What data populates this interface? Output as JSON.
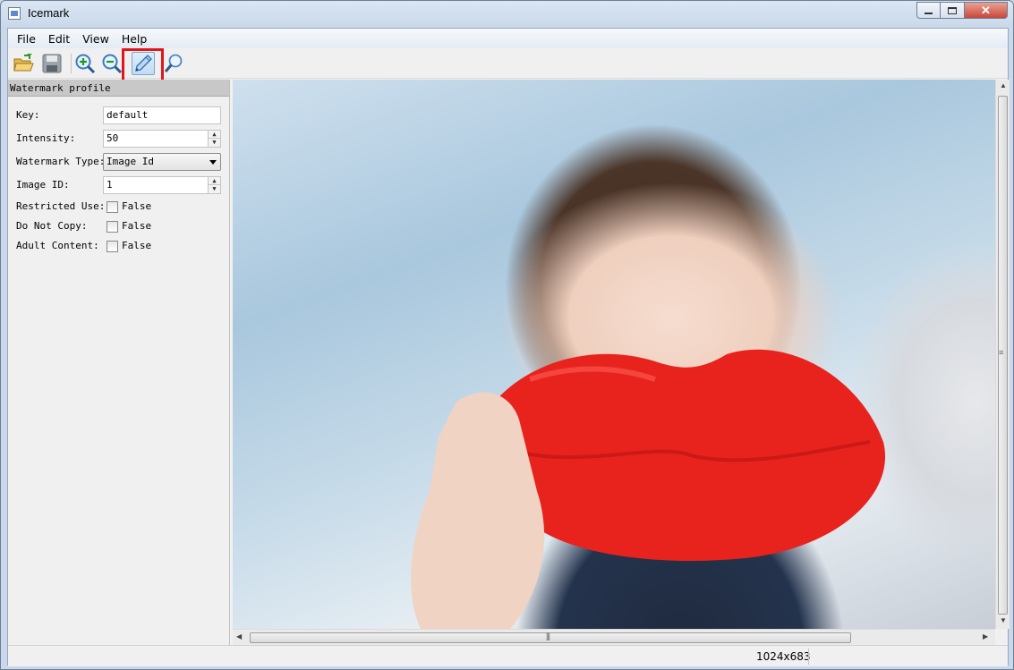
{
  "window": {
    "title": "Icemark"
  },
  "menu": {
    "items": [
      "File",
      "Edit",
      "View",
      "Help"
    ]
  },
  "toolbar": {
    "buttons": [
      {
        "name": "open-folder-icon"
      },
      {
        "name": "save-icon"
      },
      {
        "name": "zoom-in-icon"
      },
      {
        "name": "zoom-out-icon"
      },
      {
        "name": "pen-icon",
        "selected": true
      },
      {
        "name": "magnifier-icon"
      }
    ]
  },
  "panel": {
    "header": "Watermark profile",
    "key": {
      "label": "Key:",
      "value": "default"
    },
    "intensity": {
      "label": "Intensity:",
      "value": "50"
    },
    "watermark_type": {
      "label": "Watermark Type:",
      "value": "Image Id"
    },
    "image_id": {
      "label": "Image ID:",
      "value": "1"
    },
    "restricted_use": {
      "label": "Restricted Use:",
      "value": "False"
    },
    "do_not_copy": {
      "label": "Do Not Copy:",
      "value": "False"
    },
    "adult_content": {
      "label": "Adult Content:",
      "value": "False"
    }
  },
  "status": {
    "dimensions": "1024x683"
  },
  "colors": {
    "highlight": "#e0161b",
    "lips": "#e8231e"
  }
}
